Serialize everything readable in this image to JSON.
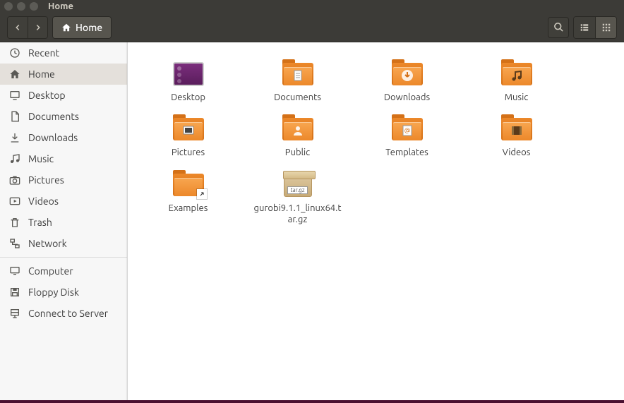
{
  "window": {
    "title": "Home"
  },
  "toolbar": {
    "breadcrumb": "Home"
  },
  "sidebar": {
    "groups": [
      [
        {
          "key": "recent",
          "label": "Recent",
          "icon": "clock",
          "selected": false
        },
        {
          "key": "home",
          "label": "Home",
          "icon": "home",
          "selected": true
        },
        {
          "key": "desktop",
          "label": "Desktop",
          "icon": "desktop",
          "selected": false
        },
        {
          "key": "documents",
          "label": "Documents",
          "icon": "doc",
          "selected": false
        },
        {
          "key": "downloads",
          "label": "Downloads",
          "icon": "download",
          "selected": false
        },
        {
          "key": "music",
          "label": "Music",
          "icon": "music",
          "selected": false
        },
        {
          "key": "pictures",
          "label": "Pictures",
          "icon": "camera",
          "selected": false
        },
        {
          "key": "videos",
          "label": "Videos",
          "icon": "video",
          "selected": false
        },
        {
          "key": "trash",
          "label": "Trash",
          "icon": "trash",
          "selected": false
        },
        {
          "key": "network",
          "label": "Network",
          "icon": "network",
          "selected": false
        }
      ],
      [
        {
          "key": "computer",
          "label": "Computer",
          "icon": "computer",
          "selected": false
        },
        {
          "key": "floppy",
          "label": "Floppy Disk",
          "icon": "floppy",
          "selected": false
        },
        {
          "key": "connect",
          "label": "Connect to Server",
          "icon": "server",
          "selected": false
        }
      ]
    ]
  },
  "files": [
    {
      "key": "desktop",
      "label": "Desktop",
      "type": "desktop"
    },
    {
      "key": "documents",
      "label": "Documents",
      "type": "folder",
      "glyph": "doc"
    },
    {
      "key": "downloads",
      "label": "Downloads",
      "type": "folder",
      "glyph": "download"
    },
    {
      "key": "music",
      "label": "Music",
      "type": "folder",
      "glyph": "music"
    },
    {
      "key": "pictures",
      "label": "Pictures",
      "type": "folder",
      "glyph": "pictures"
    },
    {
      "key": "public",
      "label": "Public",
      "type": "folder",
      "glyph": "public"
    },
    {
      "key": "templates",
      "label": "Templates",
      "type": "folder",
      "glyph": "templates"
    },
    {
      "key": "videos",
      "label": "Videos",
      "type": "folder",
      "glyph": "video"
    },
    {
      "key": "examples",
      "label": "Examples",
      "type": "folder",
      "glyph": "link"
    },
    {
      "key": "gurobi",
      "label": "gurobi9.1.1_linux64.tar.gz",
      "type": "archive",
      "archive_text": "tar.gz"
    }
  ]
}
